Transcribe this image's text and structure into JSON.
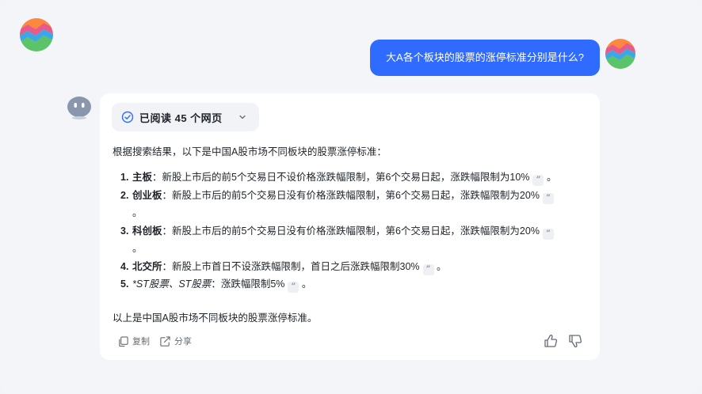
{
  "chat": {
    "user_message": "大A各个板块的股票的涨停标准分别是什么?",
    "sources_label": "已阅读 45 个网页",
    "intro": "根据搜索结果，以下是中国A股市场不同板块的股票涨停标准：",
    "items": [
      {
        "num": "1.",
        "title": "主板",
        "text": "：新股上市后的前5个交易日不设价格涨跌幅限制，第6个交易日起，涨跌幅限制为10%",
        "tail": "。"
      },
      {
        "num": "2.",
        "title": "创业板",
        "text": "：新股上市后的前5个交易日没有价格涨跌幅限制，第6个交易日起，涨跌幅限制为20%",
        "tail": "。"
      },
      {
        "num": "3.",
        "title": "科创板",
        "text": "：新股上市后的前5个交易日没有价格涨跌幅限制，第6个交易日起，涨跌幅限制为20%",
        "tail": "。"
      },
      {
        "num": "4.",
        "title": "北交所",
        "text": "：新股上市首日不设涨跌幅限制，首日之后涨跌幅限制30%",
        "tail": "。"
      },
      {
        "num": "5.",
        "title": "*ST股票、ST股票",
        "text": "：涨跌幅限制5%",
        "tail": "。"
      }
    ],
    "cite_glyph": "”",
    "outro": "以上是中国A股市场不同板块的股票涨停标准。",
    "copy_label": "复制",
    "share_label": "分享"
  },
  "colors": {
    "accent": "#2f6bff",
    "background": "#f4f5f8",
    "card": "#ffffff"
  },
  "icons": [
    "app-logo",
    "user-avatar",
    "bot-avatar",
    "check-circle-icon",
    "chevron-down-icon",
    "copy-icon",
    "share-icon",
    "thumbs-up-icon",
    "thumbs-down-icon"
  ]
}
